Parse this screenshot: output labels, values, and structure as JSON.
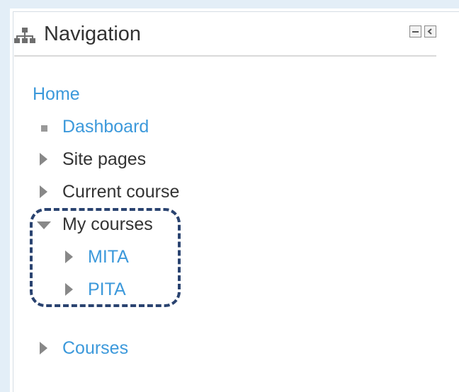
{
  "block": {
    "title": "Navigation",
    "icon": "sitemap-icon",
    "controls": [
      {
        "name": "minimize-icon"
      },
      {
        "name": "dock-icon"
      }
    ]
  },
  "nav": {
    "home": "Home",
    "dashboard": "Dashboard",
    "site_pages": "Site pages",
    "current_course": "Current course",
    "my_courses": "My courses",
    "course_1": "MITA",
    "course_2": "PITA",
    "courses": "Courses"
  },
  "colors": {
    "link": "#3c99db",
    "text": "#333333",
    "highlight": "#2a4370"
  }
}
